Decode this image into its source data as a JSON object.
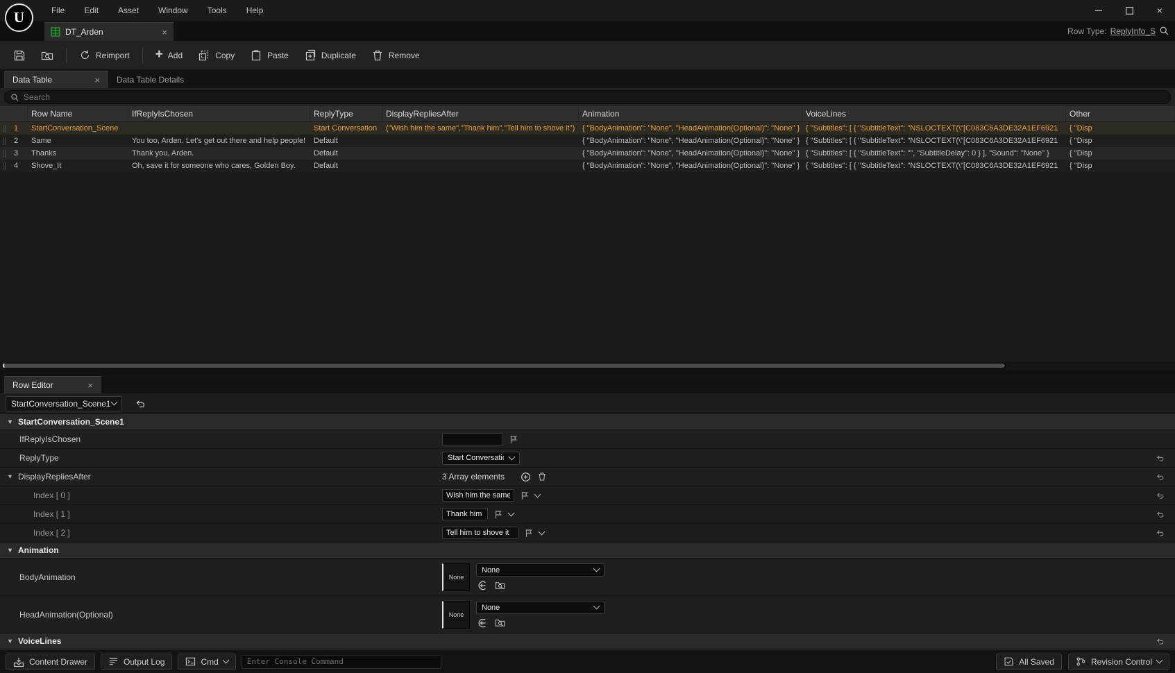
{
  "colors": {
    "selected_row_text": "#e8a23c",
    "datatable_icon_green": "#3fae46",
    "background": "#1a1a1a"
  },
  "window": {
    "menus": [
      "File",
      "Edit",
      "Asset",
      "Window",
      "Tools",
      "Help"
    ]
  },
  "doc_tab": {
    "title": "DT_Arden",
    "row_type_label": "Row Type:",
    "row_type_value": "ReplyInfo_S"
  },
  "toolbar": {
    "reimport": "Reimport",
    "add": "Add",
    "copy": "Copy",
    "paste": "Paste",
    "duplicate": "Duplicate",
    "remove": "Remove"
  },
  "panel_tabs": {
    "data_table": "Data Table",
    "details": "Data Table Details"
  },
  "search": {
    "placeholder": "Search"
  },
  "grid": {
    "columns": {
      "row_name": "Row Name",
      "if_reply": "IfReplyIsChosen",
      "reply_type": "ReplyType",
      "display_replies": "DisplayRepliesAfter",
      "animation": "Animation",
      "voice_lines": "VoiceLines",
      "other": "Other"
    },
    "rows": [
      {
        "num": "1",
        "row_name": "StartConversation_Scene",
        "if_reply": "",
        "reply_type": "Start Conversation",
        "display_replies": "(\"Wish him the same\",\"Thank him\",\"Tell him to shove it\")",
        "animation": "{ \"BodyAnimation\": \"None\", \"HeadAnimation(Optional)\": \"None\" }",
        "voice_lines": "{ \"Subtitles\": [ { \"SubtitleText\": \"NSLOCTEXT(\\\"[C083C6A3DE32A1EF6921",
        "other": "{ \"Disp"
      },
      {
        "num": "2",
        "row_name": "Same",
        "if_reply": "You too, Arden. Let's get out there and help people!",
        "reply_type": "Default",
        "display_replies": "",
        "animation": "{ \"BodyAnimation\": \"None\", \"HeadAnimation(Optional)\": \"None\" }",
        "voice_lines": "{ \"Subtitles\": [ { \"SubtitleText\": \"NSLOCTEXT(\\\"[C083C6A3DE32A1EF6921",
        "other": "{ \"Disp"
      },
      {
        "num": "3",
        "row_name": "Thanks",
        "if_reply": "Thank you, Arden.",
        "reply_type": "Default",
        "display_replies": "",
        "animation": "{ \"BodyAnimation\": \"None\", \"HeadAnimation(Optional)\": \"None\" }",
        "voice_lines": "{ \"Subtitles\": [ { \"SubtitleText\": \"\", \"SubtitleDelay\": 0 } ], \"Sound\": \"None\" }",
        "other": "{ \"Disp"
      },
      {
        "num": "4",
        "row_name": "Shove_It",
        "if_reply": "Oh, save it for someone who cares, Golden Boy.",
        "reply_type": "Default",
        "display_replies": "",
        "animation": "{ \"BodyAnimation\": \"None\", \"HeadAnimation(Optional)\": \"None\" }",
        "voice_lines": "{ \"Subtitles\": [ { \"SubtitleText\": \"NSLOCTEXT(\\\"[C083C6A3DE32A1EF6921",
        "other": "{ \"Disp"
      }
    ]
  },
  "row_editor": {
    "tab": "Row Editor",
    "row_selector": "StartConversation_Scene1",
    "section": "StartConversation_Scene1",
    "fields": {
      "if_reply_label": "IfReplyIsChosen",
      "if_reply_value": "",
      "reply_type_label": "ReplyType",
      "reply_type_value": "Start Conversation",
      "display_replies_label": "DisplayRepliesAfter",
      "array_elements": "3 Array elements",
      "index0_label": "Index [ 0 ]",
      "index0_value": "Wish him the same",
      "index1_label": "Index [ 1 ]",
      "index1_value": "Thank him",
      "index2_label": "Index [ 2 ]",
      "index2_value": "Tell him to shove it",
      "animation_section": "Animation",
      "body_anim_label": "BodyAnimation",
      "body_anim_thumb": "None",
      "body_anim_value": "None",
      "head_anim_label": "HeadAnimation(Optional)",
      "head_anim_thumb": "None",
      "head_anim_value": "None",
      "voice_section": "VoiceLines"
    }
  },
  "statusbar": {
    "content_drawer": "Content Drawer",
    "output_log": "Output Log",
    "cmd": "Cmd",
    "console_placeholder": "Enter Console Command",
    "all_saved": "All Saved",
    "revision_control": "Revision Control"
  }
}
